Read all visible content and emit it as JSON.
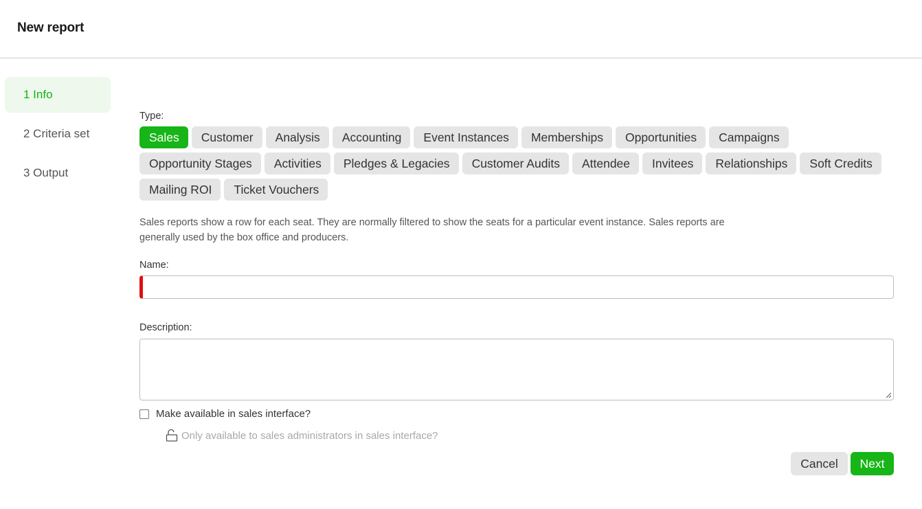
{
  "header": {
    "title": "New report"
  },
  "steps": [
    {
      "label": "1 Info",
      "active": true
    },
    {
      "label": "2 Criteria set",
      "active": false
    },
    {
      "label": "3 Output",
      "active": false
    }
  ],
  "form": {
    "type_label": "Type:",
    "type_rows": [
      [
        "Sales",
        "Customer",
        "Analysis",
        "Accounting",
        "Event Instances",
        "Memberships",
        "Opportunities",
        "Campaigns"
      ],
      [
        "Opportunity Stages",
        "Activities",
        "Pledges & Legacies",
        "Customer Audits",
        "Attendee",
        "Invitees",
        "Relationships",
        "Soft Credits"
      ],
      [
        "Mailing ROI",
        "Ticket Vouchers"
      ]
    ],
    "selected_type": "Sales",
    "type_description": "Sales reports show a row for each seat. They are normally filtered to show the seats for a particular event instance. Sales reports are generally used by the box office and producers.",
    "name_label": "Name:",
    "name_value": "",
    "description_label": "Description:",
    "description_value": "",
    "available_label": "Make available in sales interface?",
    "available_checked": false,
    "admin_only_label": "Only available to sales administrators in sales interface?"
  },
  "buttons": {
    "cancel": "Cancel",
    "next": "Next"
  },
  "colors": {
    "accent": "#17b517",
    "active_step_bg": "#eef8ed",
    "required_marker": "#e01010"
  },
  "icons": {
    "admin_only": "unlock-icon"
  }
}
